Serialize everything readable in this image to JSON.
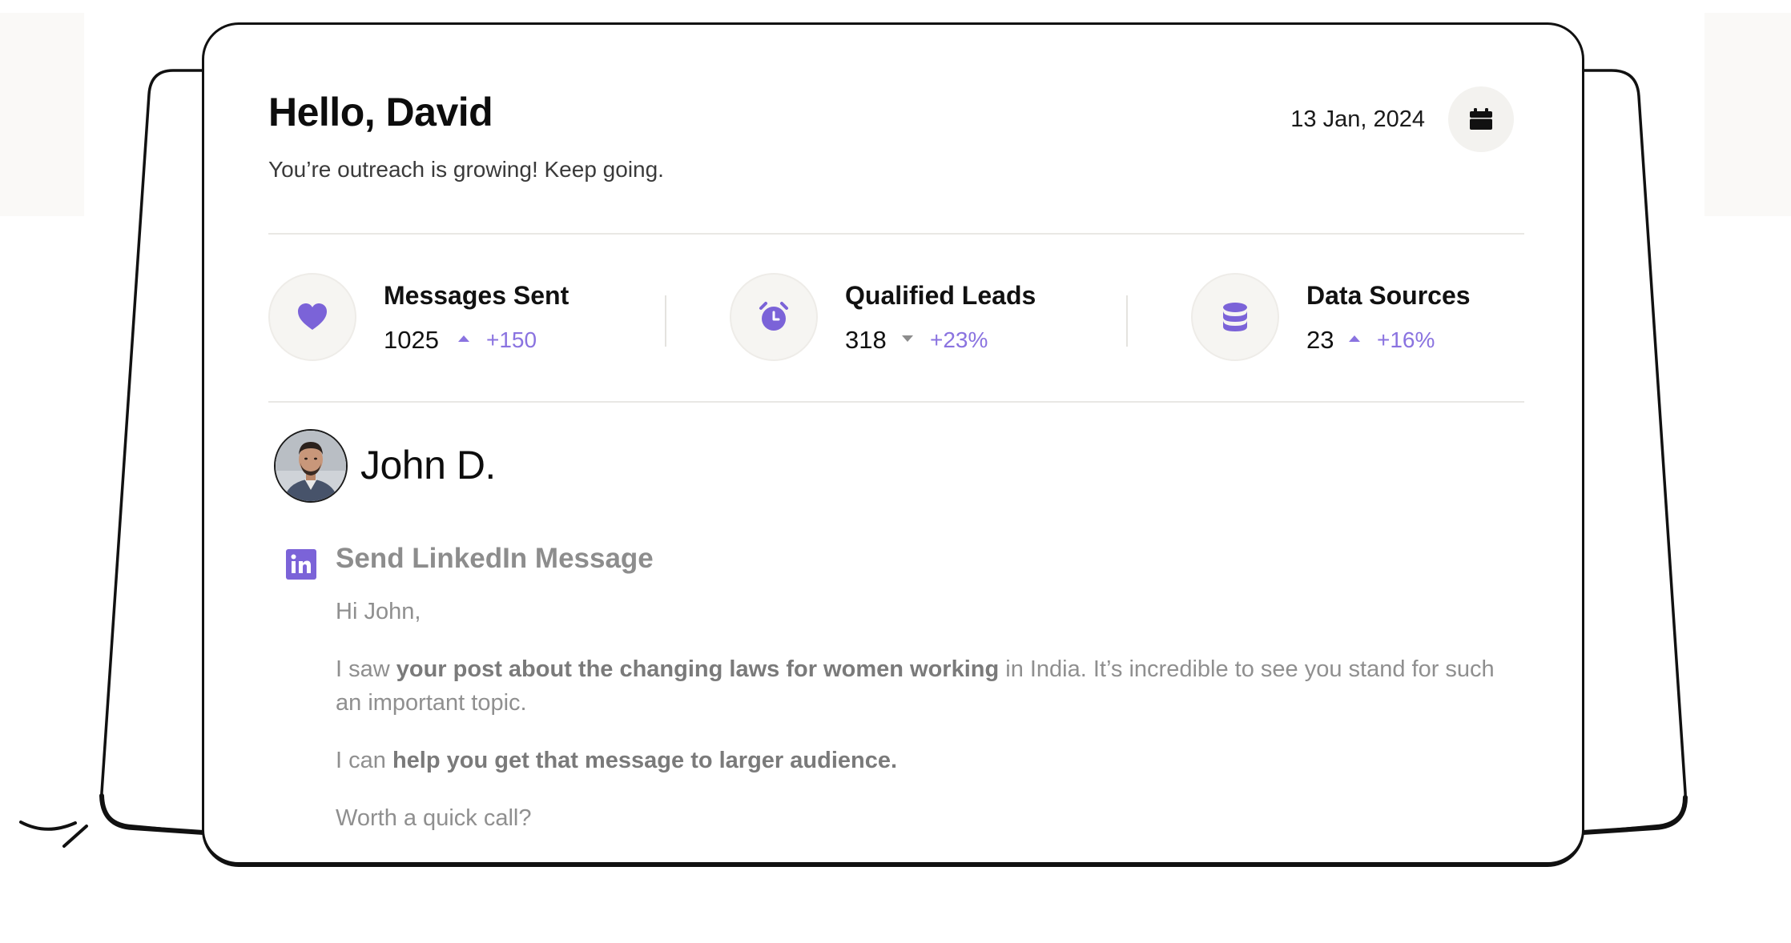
{
  "header": {
    "greeting": "Hello, David",
    "subtitle": "You’re outreach is growing! Keep going.",
    "date": "13 Jan, 2024",
    "calendar_icon": "calendar-icon"
  },
  "stats": [
    {
      "label": "Messages Sent",
      "value": "1025",
      "trend": "up",
      "change": "+150",
      "icon": "heart-icon"
    },
    {
      "label": "Qualified Leads",
      "value": "318",
      "trend": "down",
      "change": "+23%",
      "icon": "alarm-clock-icon"
    },
    {
      "label": "Data Sources",
      "value": "23",
      "trend": "up",
      "change": "+16%",
      "icon": "database-icon"
    }
  ],
  "contact": {
    "name": "John D."
  },
  "message": {
    "title": "Send LinkedIn Message",
    "greeting": "Hi John,",
    "p1_start": "I saw ",
    "p1_bold": "your post about the changing laws for women working",
    "p1_end": " in India. It’s incredible to see you stand for such an important topic.",
    "p2_start": "I can ",
    "p2_bold": "help you get that message to larger audience.",
    "p3": "Worth a quick call?"
  },
  "colors": {
    "accent": "#8a73e0",
    "icon_purple": "#7b63d8",
    "muted_text": "#8f8f8f",
    "border": "#111111"
  }
}
